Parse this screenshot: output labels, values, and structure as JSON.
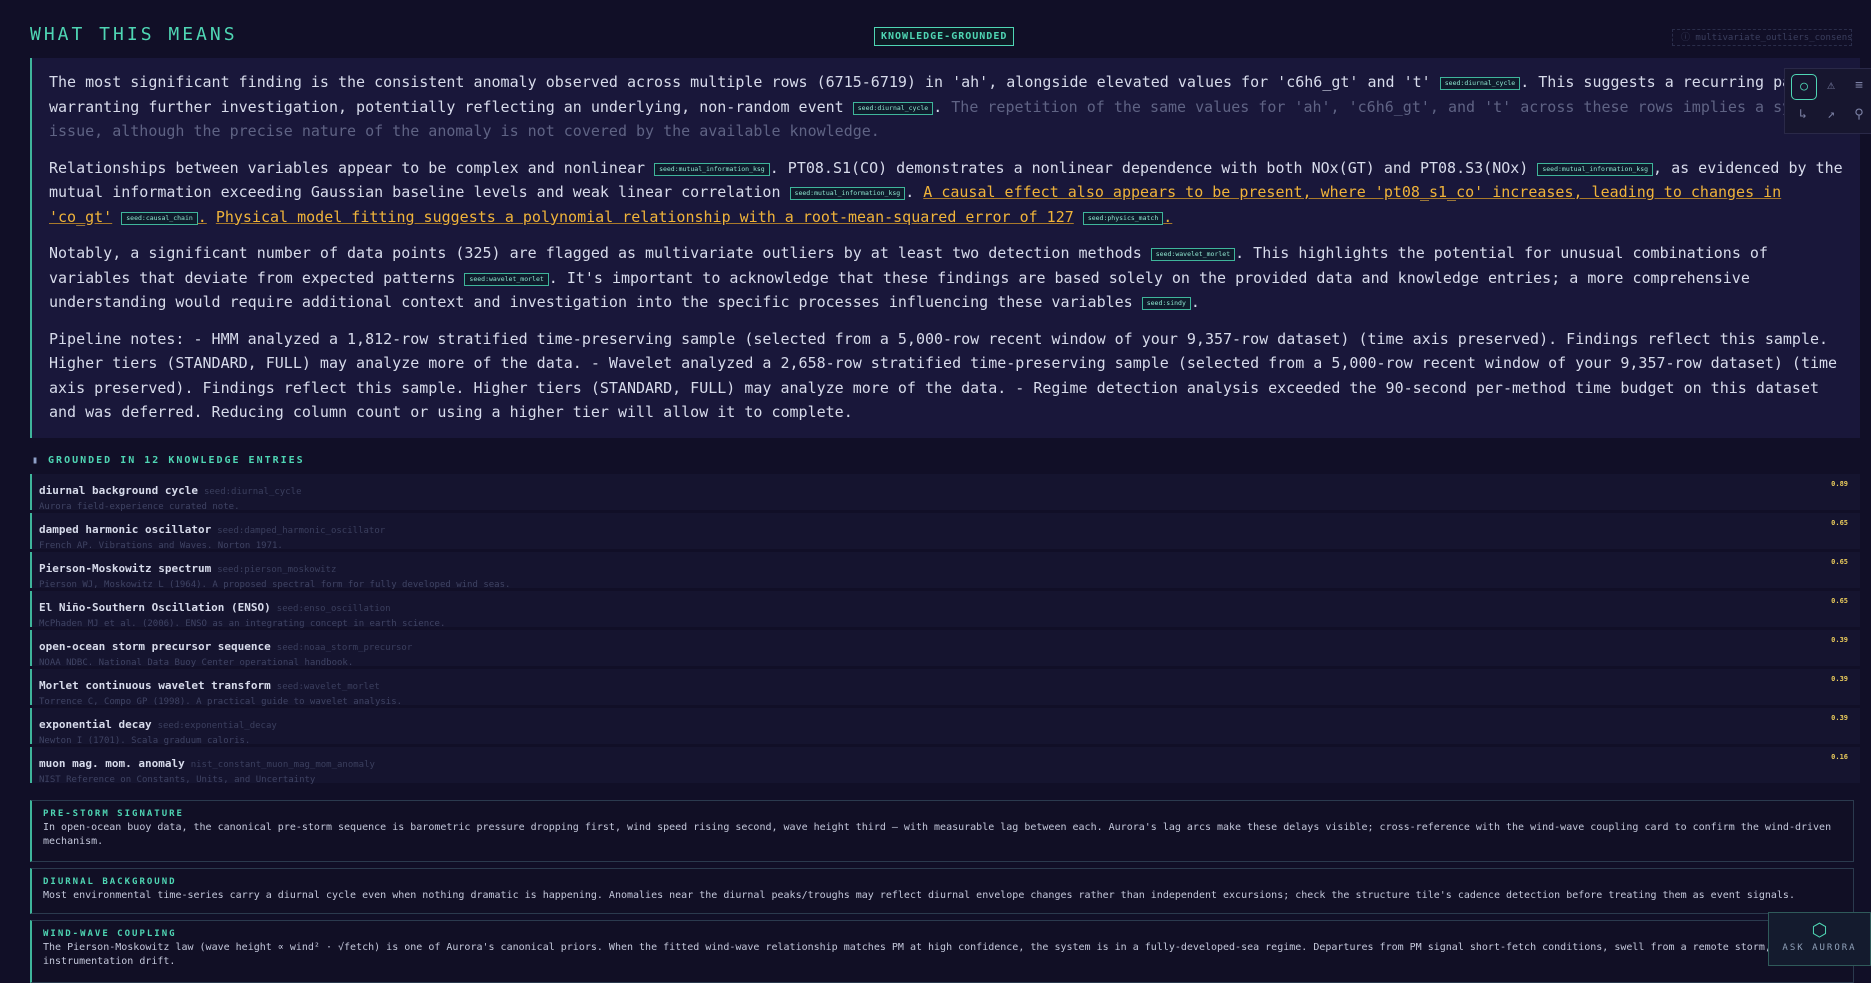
{
  "header": {
    "title": "WHAT THIS MEANS",
    "badge": "KNOWLEDGE-GROUNDED",
    "corner_badge": "ⓘ multivariate_outliers_consensus"
  },
  "summary": {
    "p1": {
      "a": "The most significant finding is the consistent anomaly observed across multiple rows (6715-6719) in 'ah', alongside elevated values for 'c6h6_gt' and 't'",
      "seed1": "seed:diurnal_cycle",
      "b": ". This suggests a recurring pattern warranting further investigation, potentially reflecting an underlying, non-random event",
      "seed2": "seed:diurnal_cycle",
      "c": ".",
      "dim": " The repetition of the same values for 'ah', 'c6h6_gt', and 't' across these rows implies a systemic issue, although the precise nature of the anomaly is not covered by the available knowledge."
    },
    "p2": {
      "a": "Relationships between variables appear to be complex and nonlinear",
      "seed1": "seed:mutual_information_ksg",
      "b": ". PT08.S1(CO) demonstrates a nonlinear dependence with both NOx(GT) and PT08.S3(NOx)",
      "seed2": "seed:mutual_information_ksg",
      "c": ", as evidenced by the mutual information exceeding Gaussian baseline levels and weak linear correlation",
      "seed3": "seed:mutual_information_ksg",
      "d": ".",
      "causal": "A causal effect also appears to be present, where 'pt08_s1_co' increases, leading to changes in 'co_gt'",
      "seed4": "seed:causal_chain",
      "e": ".",
      "physics": "Physical model fitting suggests a polynomial relationship with a root-mean-squared error of 127",
      "seed5": "seed:physics_match",
      "f": "."
    },
    "p3": {
      "a": "Notably, a significant number of data points (325) are flagged as multivariate outliers by at least two detection methods",
      "seed1": "seed:wavelet_morlet",
      "b": ". This highlights the potential for unusual combinations of variables that deviate from expected patterns",
      "seed2": "seed:wavelet_morlet",
      "c": ". It's important to acknowledge that these findings are based solely on the provided data and knowledge entries; a more comprehensive understanding would require additional context and investigation into the specific processes influencing these variables",
      "seed3": "seed:sindy",
      "d": "."
    },
    "p4": "Pipeline notes: - HMM analyzed a 1,812-row stratified time-preserving sample (selected from a 5,000-row recent window of your 9,357-row dataset) (time axis preserved). Findings reflect this sample. Higher tiers (STANDARD, FULL) may analyze more of the data. - Wavelet analyzed a 2,658-row stratified time-preserving sample (selected from a 5,000-row recent window of your 9,357-row dataset) (time axis preserved). Findings reflect this sample. Higher tiers (STANDARD, FULL) may analyze more of the data. - Regime detection analysis exceeded the 90-second per-method time budget on this dataset and was deferred. Reducing column count or using a higher tier will allow it to complete."
  },
  "toolbar": {
    "icons": [
      "circle-icon",
      "warning-icon",
      "menu-icon",
      "hook-icon",
      "arrow-icon",
      "pin-icon"
    ]
  },
  "grounded": {
    "heading": "GROUNDED IN 12 KNOWLEDGE ENTRIES",
    "entries": [
      {
        "title": "diurnal background cycle",
        "seed": "seed:diurnal_cycle",
        "desc": "Aurora field-experience curated note.",
        "score": "0.89"
      },
      {
        "title": "damped harmonic oscillator",
        "seed": "seed:damped_harmonic_oscillator",
        "desc": "French AP. Vibrations and Waves. Norton 1971.",
        "score": "0.65"
      },
      {
        "title": "Pierson-Moskowitz spectrum",
        "seed": "seed:pierson_moskowitz",
        "desc": "Pierson WJ, Moskowitz L (1964). A proposed spectral form for fully developed wind seas.",
        "score": "0.65"
      },
      {
        "title": "El Niño-Southern Oscillation (ENSO)",
        "seed": "seed:enso_oscillation",
        "desc": "McPhaden MJ et al. (2006). ENSO as an integrating concept in earth science.",
        "score": "0.65"
      },
      {
        "title": "open-ocean storm precursor sequence",
        "seed": "seed:noaa_storm_precursor",
        "desc": "NOAA NDBC. National Data Buoy Center operational handbook.",
        "score": "0.39"
      },
      {
        "title": "Morlet continuous wavelet transform",
        "seed": "seed:wavelet_morlet",
        "desc": "Torrence C, Compo GP (1998). A practical guide to wavelet analysis.",
        "score": "0.39"
      },
      {
        "title": "exponential decay",
        "seed": "seed:exponential_decay",
        "desc": "Newton I (1701). Scala graduum caloris.",
        "score": "0.39"
      },
      {
        "title": "muon mag. mom. anomaly",
        "seed": "nist_constant_muon_mag_mom_anomaly",
        "desc": "NIST Reference on Constants, Units, and Uncertainty",
        "score": "0.16"
      }
    ]
  },
  "cards": [
    {
      "title": "PRE-STORM SIGNATURE",
      "text": "In open-ocean buoy data, the canonical pre-storm sequence is barometric pressure dropping first, wind speed rising second, wave height third — with measurable lag between each. Aurora's lag arcs make these delays visible; cross-reference with the wind-wave coupling card to confirm the wind-driven mechanism."
    },
    {
      "title": "DIURNAL BACKGROUND",
      "text": "Most environmental time-series carry a diurnal cycle even when nothing dramatic is happening. Anomalies near the diurnal peaks/troughs may reflect diurnal envelope changes rather than independent excursions; check the structure tile's cadence detection before treating them as event signals."
    },
    {
      "title": "WIND-WAVE COUPLING",
      "text": "The Pierson-Moskowitz law (wave height ∝ wind² · √fetch) is one of Aurora's canonical priors. When the fitted wind-wave relationship matches PM at high confidence, the system is in a fully-developed-sea regime. Departures from PM signal short-fetch conditions, swell from a remote storm, or instrumentation drift."
    }
  ],
  "ask": {
    "label": "ASK AURORA",
    "icon": "aurora-hex-icon"
  }
}
